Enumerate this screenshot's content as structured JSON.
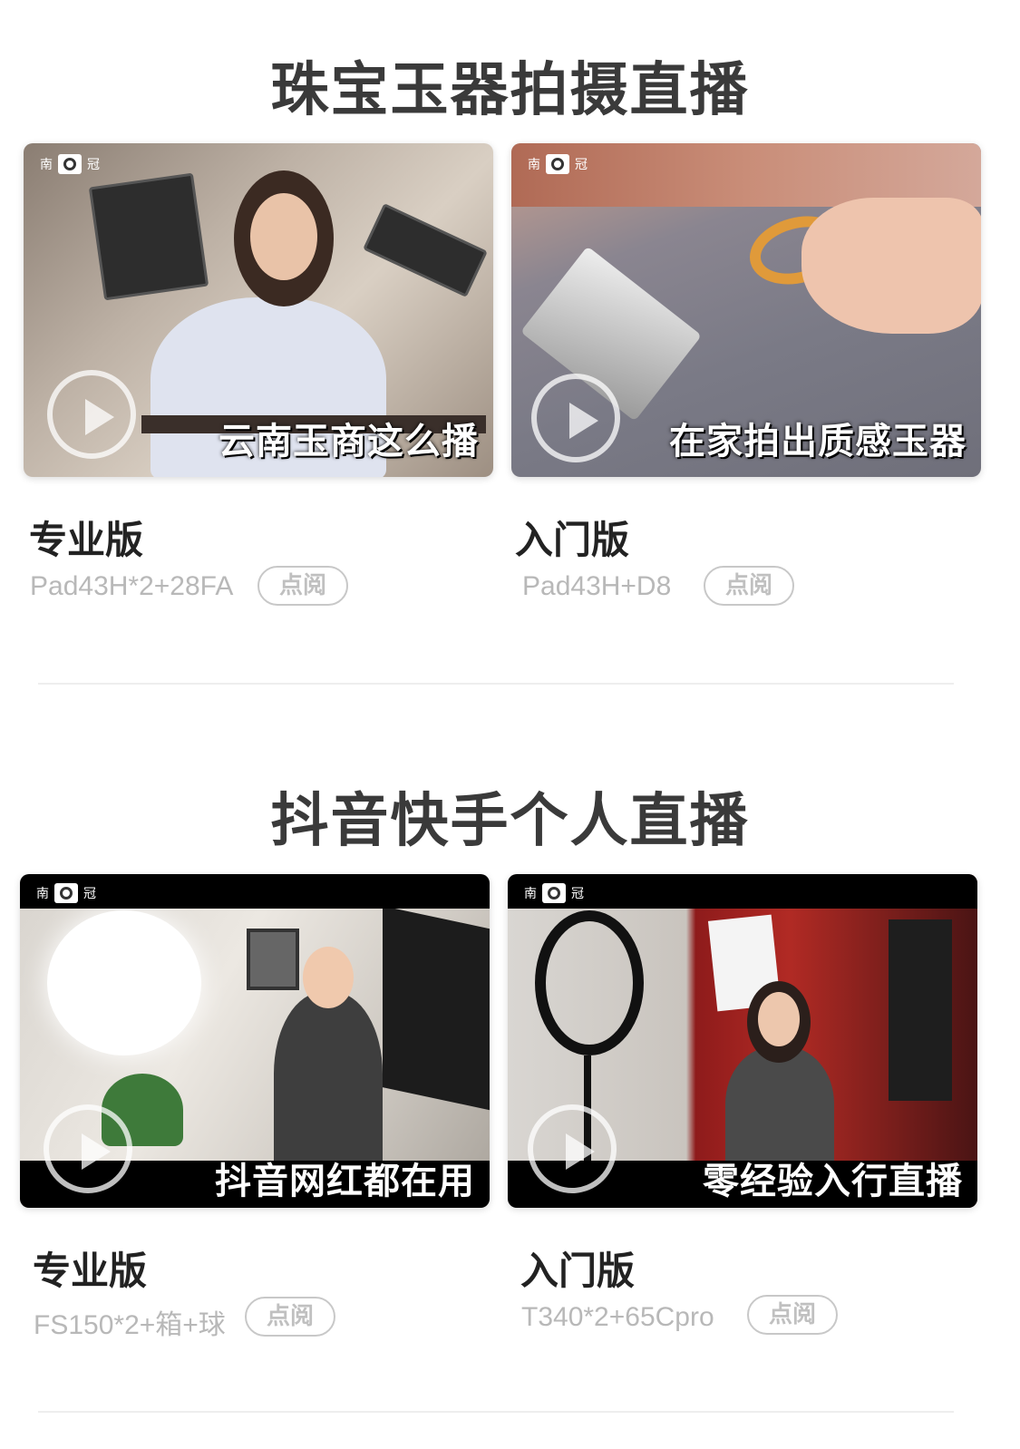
{
  "sections": [
    {
      "title": "珠宝玉器拍摄直播",
      "cards": [
        {
          "logo_left": "南",
          "logo_right": "冠",
          "caption": "云南玉商这么播",
          "version": "专业版",
          "model": "Pad43H*2+28FA",
          "button": "点阅"
        },
        {
          "logo_left": "南",
          "logo_right": "冠",
          "caption": "在家拍出质感玉器",
          "version": "入门版",
          "model": "Pad43H+D8",
          "button": "点阅"
        }
      ]
    },
    {
      "title": "抖音快手个人直播",
      "cards": [
        {
          "logo_left": "南",
          "logo_right": "冠",
          "caption": "抖音网红都在用",
          "version": "专业版",
          "model": "FS150*2+箱+球",
          "button": "点阅"
        },
        {
          "logo_left": "南",
          "logo_right": "冠",
          "caption": "零经验入行直播",
          "version": "入门版",
          "model": "T340*2+65Cpro",
          "button": "点阅"
        }
      ]
    }
  ],
  "icons": {
    "play": "play-circle-icon",
    "brand": "brand-logo-icon"
  },
  "colors": {
    "title": "#3a3a3a",
    "version": "#222222",
    "model": "#b8b8b8",
    "button_border": "#c8c8c8"
  }
}
